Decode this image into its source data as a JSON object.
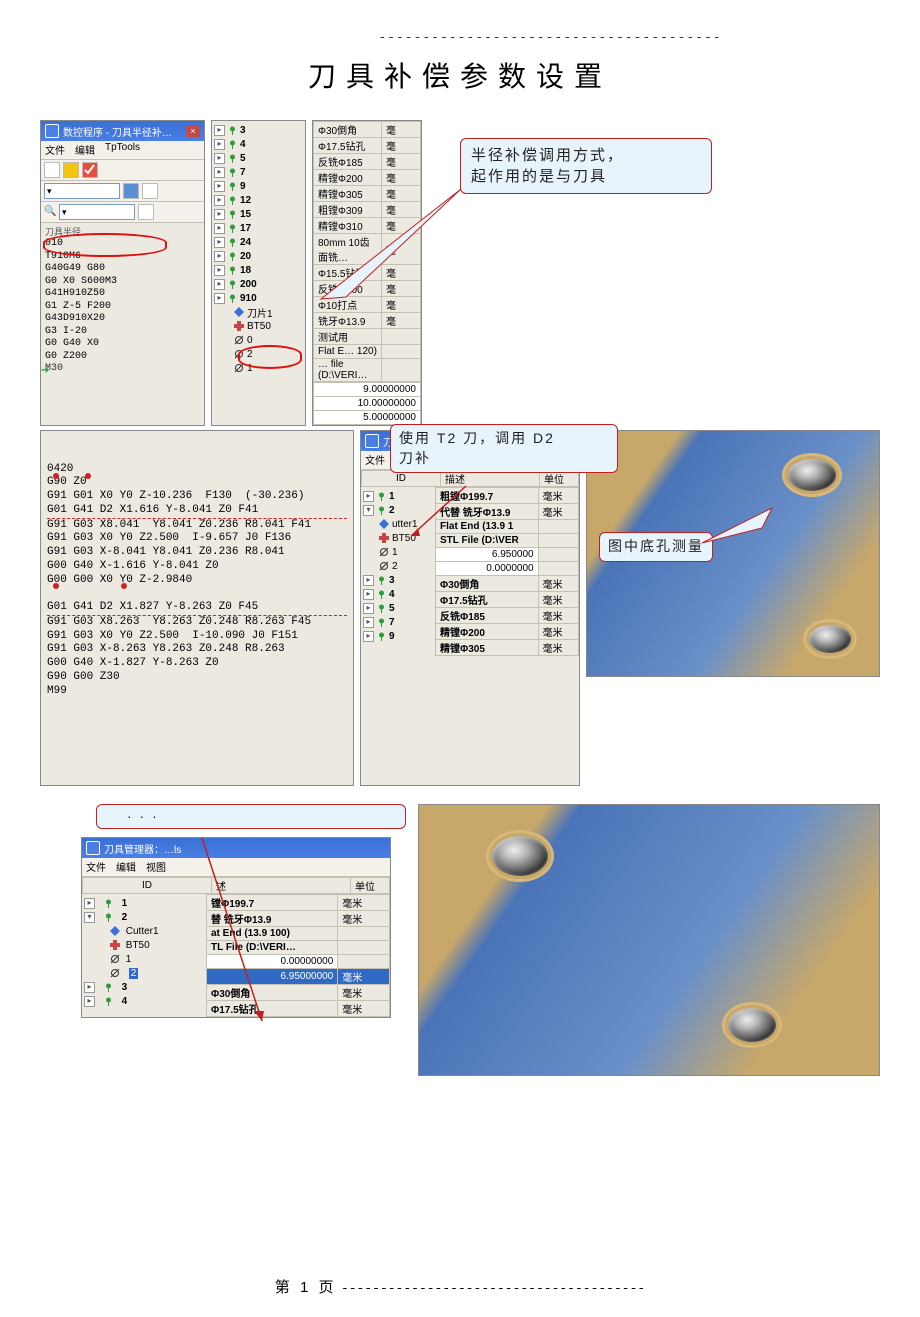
{
  "doc": {
    "title": "刀具补偿参数设置",
    "footer_page": "第 1 页",
    "dashes": "---------------------------------------"
  },
  "callouts": {
    "radius": {
      "l1": "半径补偿调用方式，",
      "l2": "起作用的是与刀具"
    },
    "useT2": {
      "l1": "使用 T2 刀，调用 D2",
      "l2": "刀补"
    },
    "measure": {
      "l1": "图中底孔测量"
    },
    "truncated": {
      "l": "· · ·"
    }
  },
  "panel_nc": {
    "title": "数控程序 - 刀具半径补…",
    "menu": [
      "文件",
      "编辑",
      "TpTools"
    ],
    "group_label": "刀具半径",
    "code": [
      "010",
      "T910M6",
      "G40G49 G80",
      "G0 X0  S600M3",
      "G41H910Z50",
      "G1 Z-5 F200",
      "G43D910X20",
      "G3 I-20",
      "G0 G40 X0",
      "G0 Z200",
      "M30"
    ],
    "arrow_line": 10
  },
  "panel_tree1": {
    "items": [
      {
        "id": "3"
      },
      {
        "id": "4"
      },
      {
        "id": "5"
      },
      {
        "id": "7"
      },
      {
        "id": "9"
      },
      {
        "id": "12"
      },
      {
        "id": "15"
      },
      {
        "id": "17"
      },
      {
        "id": "24"
      },
      {
        "id": "20"
      },
      {
        "id": "18"
      },
      {
        "id": "200"
      },
      {
        "id": "910"
      }
    ],
    "sub": [
      "刀片1",
      "BT50"
    ],
    "offsets": [
      {
        "k": "0"
      },
      {
        "k": "2"
      },
      {
        "k": "1"
      }
    ]
  },
  "panel_grid1": {
    "rows": [
      {
        "a": "Φ30倒角",
        "b": "毫"
      },
      {
        "a": "Φ17.5钻孔",
        "b": "毫"
      },
      {
        "a": "反铣Φ185",
        "b": "毫"
      },
      {
        "a": "精镗Φ200",
        "b": "毫"
      },
      {
        "a": "精镗Φ305",
        "b": "毫"
      },
      {
        "a": "粗镗Φ309",
        "b": "毫"
      },
      {
        "a": "精镗Φ310",
        "b": "毫"
      },
      {
        "a": "80mm 10齿面铣…",
        "b": "毫"
      },
      {
        "a": "Φ15.5钻孔",
        "b": "毫"
      },
      {
        "a": "反铣Φ300",
        "b": "毫"
      },
      {
        "a": "Φ10打点",
        "b": "毫"
      },
      {
        "a": "铣牙Φ13.9",
        "b": "毫"
      },
      {
        "a": "测试用",
        "b": ""
      },
      {
        "a": "Flat E…  120)",
        "b": ""
      },
      {
        "a": "… file (D:\\VERI…",
        "b": ""
      }
    ],
    "vals": [
      {
        "v": "9.00000000"
      },
      {
        "v": "10.00000000"
      },
      {
        "v": "5.00000000"
      }
    ]
  },
  "gcode_block": {
    "lines": [
      "0420",
      "G90 Z0",
      "G91 G01 X0 Y0 Z-10.236  F130  (-30.236)",
      "G01 G41 D2 X1.616 Y-8.041 Z0 F41",
      "G91 G03 X8.041  Y8.041 Z0.236 R8.041 F41",
      "G91 G03 X0 Y0 Z2.500  I-9.657 J0 F136",
      "G91 G03 X-8.041 Y8.041 Z0.236 R8.041",
      "G00 G40 X-1.616 Y-8.041 Z0",
      "G00 G00 X0 Y0 Z-2.9840",
      "",
      "G01 G41 D2 X1.827 Y-8.263 Z0 F45",
      "G91 G03 X8.263  Y8.263 Z0.248 R8.263 F45",
      "G91 G03 X0 Y0 Z2.500  I-10.090 J0 F151",
      "G91 G03 X-8.263 Y8.263 Z0.248 R8.263",
      "G00 G40 X-1.827 Y-8.263 Z0",
      "G90 G00 Z30",
      "M99"
    ]
  },
  "panel_mid_right": {
    "title": "刀具",
    "menu": [
      "文件"
    ],
    "hdr_id": "ID",
    "hdr_desc": "描述",
    "hdr_unit": "单位",
    "items": [
      {
        "id": "1"
      },
      {
        "id": "2"
      }
    ],
    "sub": [
      "utter1",
      "BT50"
    ],
    "offs": [
      "1",
      "2"
    ],
    "rrows": [
      {
        "a": "粗镗Φ199.7",
        "u": "毫米"
      },
      {
        "a": "代替 铣牙Φ13.9",
        "u": "毫米"
      },
      {
        "a": "Flat End (13.9 1",
        "u": ""
      },
      {
        "a": "STL File (D:\\VER",
        "u": ""
      },
      {
        "a": "6.950000",
        "u": "",
        "val": true
      },
      {
        "a": "0.0000000",
        "u": "",
        "val": true
      },
      {
        "a": "Φ30倒角",
        "u": "毫米"
      },
      {
        "a": "Φ17.5钻孔",
        "u": "毫米"
      },
      {
        "a": "反铣Φ185",
        "u": "毫米"
      },
      {
        "a": "精镗Φ200",
        "u": "毫米"
      },
      {
        "a": "精镗Φ305",
        "u": "毫米"
      }
    ],
    "more": [
      "3",
      "4",
      "5",
      "7",
      "9"
    ]
  },
  "panel_bottom": {
    "title": "刀具管理器：…ls",
    "menu": [
      "文件",
      "编辑",
      "视图"
    ],
    "hdr_id": "ID",
    "hdr_desc": "述",
    "hdr_unit": "单位",
    "items": [
      {
        "id": "1"
      },
      {
        "id": "2"
      }
    ],
    "sub": [
      "Cutter1",
      "BT50"
    ],
    "offs": [
      "1",
      "2"
    ],
    "more": [
      "3",
      "4"
    ],
    "rrows": [
      {
        "a": "镗Φ199.7",
        "u": "毫米"
      },
      {
        "a": "替 铣牙Φ13.9",
        "u": "毫米"
      },
      {
        "a": "at End (13.9 100)",
        "u": ""
      },
      {
        "a": "TL File (D:\\VERI…",
        "u": ""
      },
      {
        "a": "0.00000000",
        "u": "",
        "val": true
      },
      {
        "a": "6.95000000",
        "u": "毫米",
        "sel": true
      },
      {
        "a": "Φ30倒角",
        "u": "毫米"
      },
      {
        "a": "Φ17.5钻孔",
        "u": "毫米"
      }
    ]
  }
}
